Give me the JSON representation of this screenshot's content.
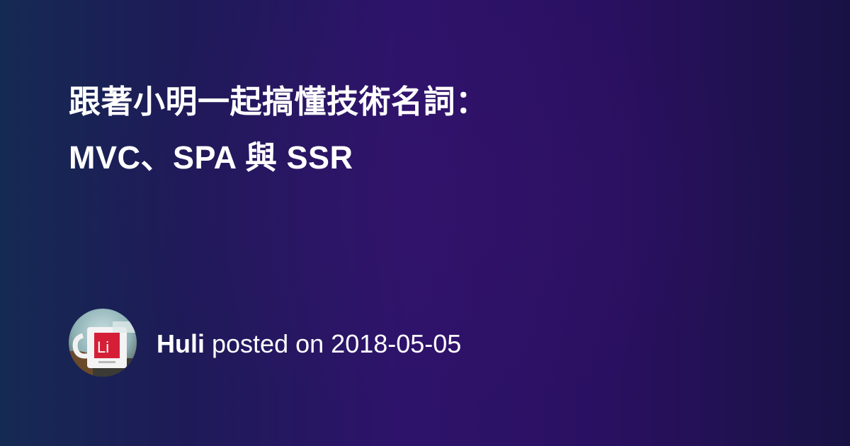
{
  "post": {
    "title_line1": "跟著小明一起搞懂技術名詞：",
    "title_line2": "MVC、SPA 與 SSR"
  },
  "author": {
    "name": "Huli",
    "posted_on_text": "posted on",
    "date": "2018-05-05",
    "avatar_icon": "mug-photo-avatar"
  },
  "colors": {
    "background_left": "#152a52",
    "background_mid": "#2e136b",
    "background_right": "#181244",
    "text": "#ffffff"
  }
}
